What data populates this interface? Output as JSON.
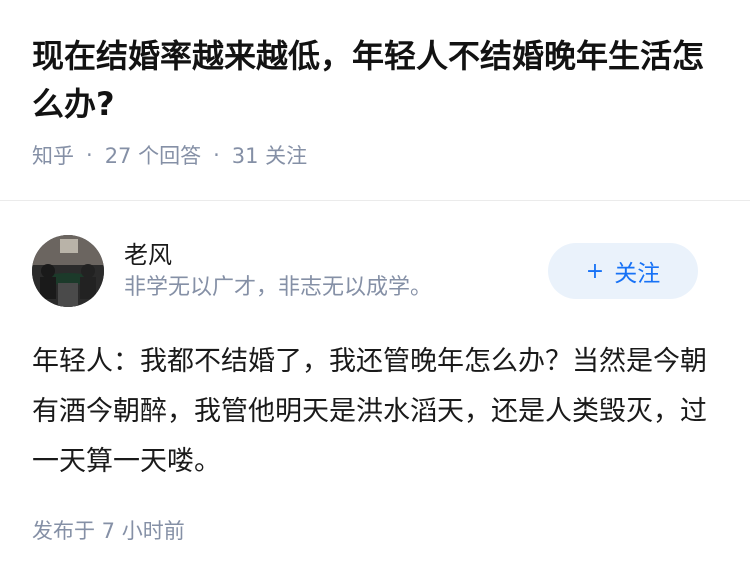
{
  "question": {
    "title": "现在结婚率越来越低，年轻人不结婚晚年生活怎么办?",
    "source": "知乎",
    "answers_count": "27 个回答",
    "followers_count": "31 关注",
    "separator": "·"
  },
  "answer": {
    "author_name": "老风",
    "author_bio": "非学无以广才，非志无以成学。",
    "follow_button": {
      "icon": "+",
      "label": "关注"
    },
    "content": "年轻人：我都不结婚了，我还管晚年怎么办？当然是今朝有酒今朝醉，我管他明天是洪水滔天，还是人类毁灭，过一天算一天喽。",
    "published": "发布于  7 小时前"
  },
  "colors": {
    "meta_gray": "#8590a6",
    "accent_blue": "#1772f6",
    "button_bg": "#eaf2fb"
  }
}
